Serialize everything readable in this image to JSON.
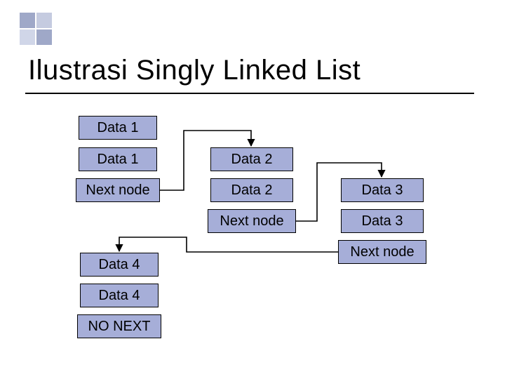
{
  "title": "Ilustrasi Singly Linked List",
  "node1": {
    "top": "Data 1",
    "mid": "Data 1",
    "next": "Next node"
  },
  "node2": {
    "top": "Data 2",
    "mid": "Data 2",
    "next": "Next node"
  },
  "node3": {
    "top": "Data 3",
    "mid": "Data 3",
    "next": "Next node"
  },
  "node4": {
    "top": "Data 4",
    "mid": "Data 4",
    "next": "NO NEXT"
  },
  "colors": {
    "cell_fill": "#a6aed8",
    "accent": "#9fa8c8"
  }
}
